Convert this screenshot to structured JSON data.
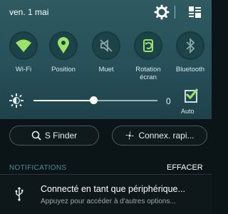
{
  "status": {
    "date": "ven. 1 mai"
  },
  "quick_settings": [
    {
      "label": "Wi-Fi",
      "icon": "wifi-icon",
      "active": true
    },
    {
      "label": "Position",
      "icon": "location-icon",
      "active": true
    },
    {
      "label": "Muet",
      "icon": "mute-icon",
      "active": false
    },
    {
      "label": "Rotation\nécran",
      "icon": "rotation-icon",
      "active": true
    },
    {
      "label": "Bluetooth",
      "icon": "bluetooth-icon",
      "active": false
    }
  ],
  "brightness": {
    "value": "0",
    "auto_label": "Auto",
    "auto_checked": true,
    "level": 0.48
  },
  "actions": {
    "sfinder": "S Finder",
    "quick_connect": "Connex. rapi..."
  },
  "notifications": {
    "header": "NOTIFICATIONS",
    "clear": "EFFACER",
    "items": [
      {
        "title": "Connecté en tant que périphérique...",
        "subtitle": "Appuyez pour accéder à d'autres options..."
      }
    ]
  },
  "colors": {
    "panel": "#2e5a60",
    "active_icon": "#9be36a",
    "inactive_icon": "#8fa7ab",
    "background": "#0b1417"
  }
}
